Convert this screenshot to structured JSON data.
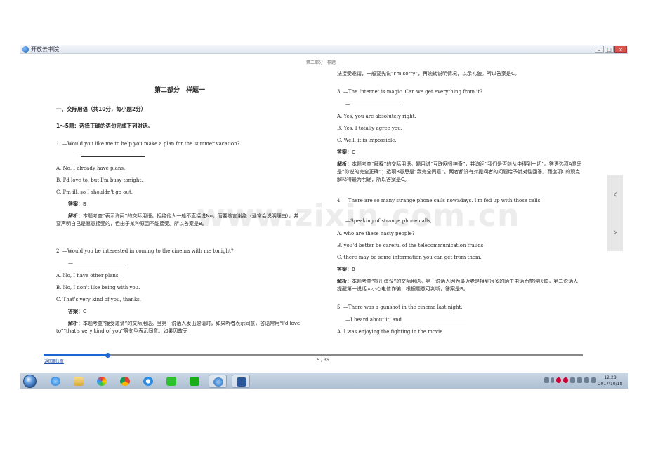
{
  "window": {
    "title": "开放云书院",
    "minimize": "–",
    "maximize": "□",
    "close": "×"
  },
  "running_head": "第二部分　样题一",
  "left": {
    "section_title": "第二部分　样题一",
    "part_heading": "一、交际用语（共10分，每小题2分）",
    "instruction": "1～5题：选择正确的语句完成下列对话。",
    "q1": {
      "stem": "1. —Would you like me to help you make a plan for the summer vacation?",
      "dash": "—",
      "a": "A. No, I already have plans.",
      "b": "B. I'd love to, but I'm busy tonight.",
      "c": "C. I'm ill, so I shouldn't go out.",
      "answer_label": "答案：",
      "answer": "B",
      "expl_label": "解析：",
      "expl": "本题考查“表示询问”的交际用语。拒绝他人一般不直接说No。而要婉言谢绝（通常会说明理由），并要声明自己是愿意接受的，但由于某种原因不能接受。所以答案是B。"
    },
    "q2": {
      "stem": "2. —Would you be interested in coming to the cinema with me tonight?",
      "dash": "—",
      "a": "A. No, I have other plans.",
      "b": "B. No, I don't like being with you.",
      "c": "C. That's very kind of you, thanks.",
      "answer_label": "答案：",
      "answer": "C",
      "expl_label": "解析：",
      "expl": "本题考查“接受邀请”的交际用语。当第一说话人发出邀请时，如果听者表示同意，答语常用“I'd love to”“that's very kind of you”等句型表示同意。如果因故无"
    }
  },
  "right": {
    "cont": "法接受邀请，一般要先说“I'm sorry”，再婉转说明情况，以示礼貌。所以答案是C。",
    "q3": {
      "stem": "3. —The Internet is magic. Can we get everything from it?",
      "dash": "—",
      "a": "A. Yes, you are absolutely right.",
      "b": "B. Yes, I totally agree you.",
      "c": "C. Well, it is impossible.",
      "answer_label": "答案：",
      "answer": "C",
      "expl_label": "解析：",
      "expl": "本题考查“解释”的交际用语。题目说“互联网很神奇”，并询问“我们是否能从中得到一切”。答语选项A意思是“你说的完全正确”；选项B意思是“我完全同意”。两者都没有对提问者的问题给予针对性回答。而选项C的观点解释得最为明确，所以答案是C。"
    },
    "q4": {
      "stem": "4. —There are so many strange phone calls nowadays. I'm fed up with those calls.",
      "reply": "—Speaking of strange phone calls,",
      "a": "A. who are these nasty people?",
      "b": "B. you'd better be careful of the telecommunication frauds.",
      "c": "C. there may be some information you can get from them.",
      "answer_label": "答案：",
      "answer": "B",
      "expl_label": "解析：",
      "expl": "本题考查“提出建议”的交际用语。第一说话人因为最近老是接到很多的陌生电话而觉得厌烦，第二说话人提醒第一说话人小心电信诈骗，根据题意可判断，答案是B。"
    },
    "q5": {
      "stem": "5. —There was a gunshot in the cinema last night.",
      "reply": "—I heard about it, and",
      "a": "A. I was enjoying the fighting in the movie."
    }
  },
  "watermark": "www.zixin.com.cn",
  "footer": {
    "back_link": "返回到1页",
    "page": "5 / 36",
    "progress_fraction": 0.118
  },
  "taskbar": {
    "icons": [
      "start-orb-icon",
      "ie-browser-icon",
      "file-explorer-icon",
      "media-player-icon",
      "chrome-icon",
      "qq-browser-icon",
      "iqiyi-icon",
      "wechat-icon",
      "open-reader-icon",
      "word-icon"
    ],
    "clock_time": "12:28",
    "clock_date": "2017/10/18"
  }
}
